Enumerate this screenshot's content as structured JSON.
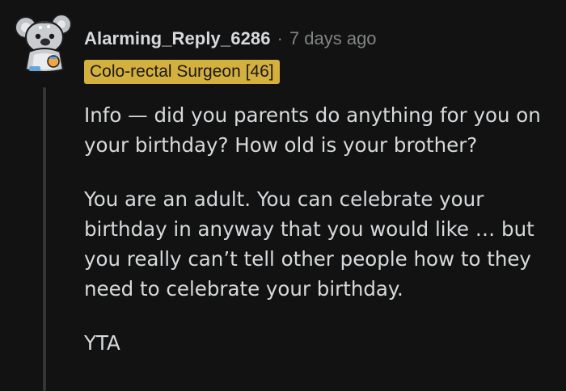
{
  "comment": {
    "username": "Alarming_Reply_6286",
    "separator": "·",
    "timestamp": "7 days ago",
    "flair": "Colo-rectal Surgeon [46]",
    "paragraphs": [
      "Info — did you parents do anything for you on your birthday? How old is your brother?",
      "You are an adult. You can celebrate your birthday in anyway that you would like … but you really can’t tell other people how to they need to celebrate your birthday.",
      "YTA"
    ]
  },
  "colors": {
    "background": "#121212",
    "text": "#d7dadc",
    "muted": "#818384",
    "flair_bg": "#d4b03e",
    "thread_line": "#343536"
  },
  "icons": {
    "avatar": "snoo-koala-avatar-icon"
  }
}
